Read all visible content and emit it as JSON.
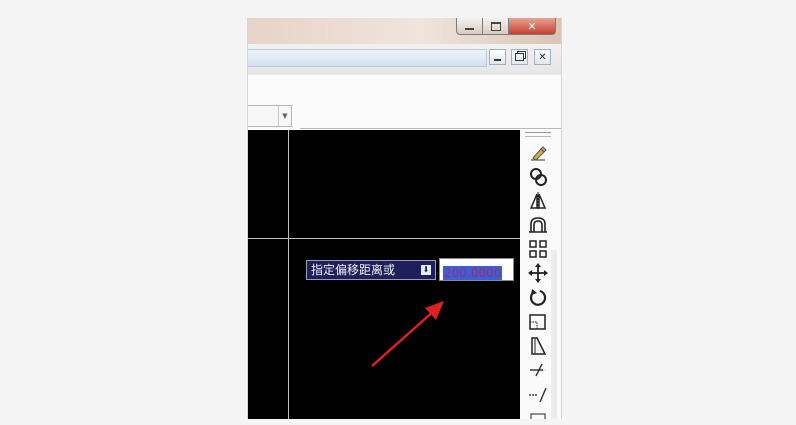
{
  "window": {
    "title_buttons": [
      "minimize",
      "maximize",
      "close"
    ],
    "close_glyph": "✕",
    "max_glyph": "▭",
    "min_glyph": "▁"
  },
  "document": {
    "buttons": [
      "minimize",
      "restore",
      "close"
    ]
  },
  "command_prompt": {
    "label": "指定偏移距离或",
    "button_glyph": "⬇"
  },
  "input": {
    "value": "200.0000"
  },
  "toolbar": {
    "items": [
      "erase-icon",
      "copy-icon",
      "mirror-icon",
      "offset-icon",
      "array-icon",
      "move-icon",
      "rotate-icon",
      "scale-icon",
      "stretch-icon",
      "trim-icon",
      "extend-icon"
    ]
  },
  "colors": {
    "canvas": "#000000",
    "prompt_bg": "#1f1f5c",
    "selection": "#3d5fd6",
    "arrow": "#e02020"
  }
}
